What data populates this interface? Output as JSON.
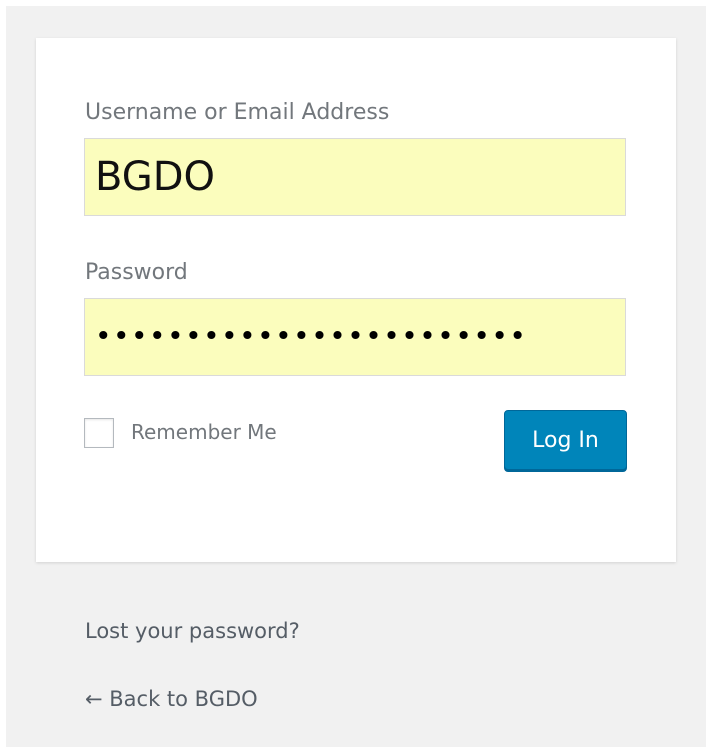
{
  "form": {
    "username_label": "Username or Email Address",
    "username_value": "BGDO",
    "password_label": "Password",
    "password_value": "••••••••••••••••••••••••",
    "remember_label": "Remember Me",
    "login_label": "Log In"
  },
  "links": {
    "lost_password": "Lost your password?",
    "back_to_site": "← Back to BGDO"
  },
  "colors": {
    "background": "#f1f1f1",
    "card": "#ffffff",
    "autofill": "#fbfdbd",
    "button": "#0085ba"
  }
}
